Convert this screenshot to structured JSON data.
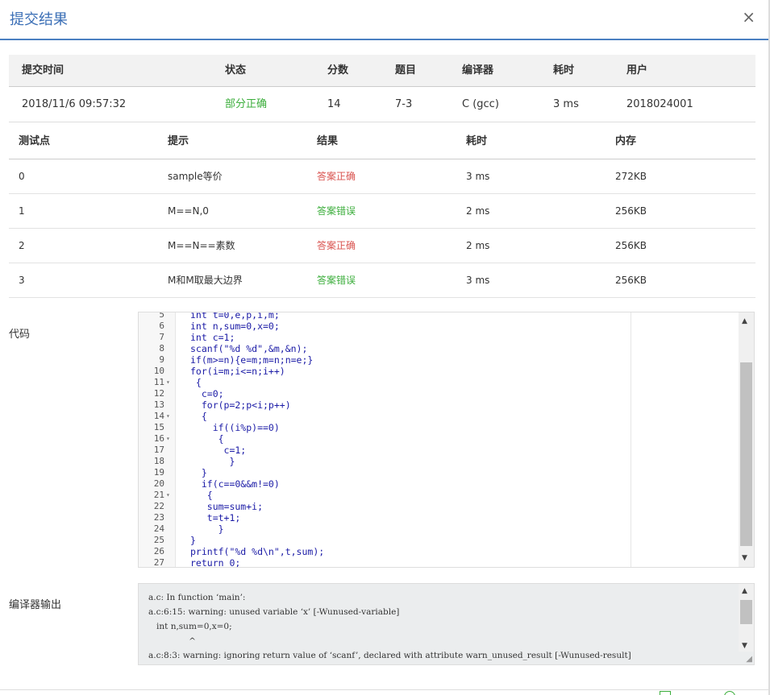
{
  "modal": {
    "title": "提交结果",
    "close": "×"
  },
  "summary": {
    "headers": [
      "提交时间",
      "状态",
      "分数",
      "题目",
      "编译器",
      "耗时",
      "用户"
    ],
    "row": [
      "2018/11/6 09:57:32",
      "部分正确",
      "14",
      "7-3",
      "C (gcc)",
      "3 ms",
      "2018024001"
    ]
  },
  "tests": {
    "headers": [
      "测试点",
      "提示",
      "结果",
      "耗时",
      "内存"
    ],
    "rows": [
      [
        "0",
        "sample等价",
        "答案正确",
        "3 ms",
        "272KB"
      ],
      [
        "1",
        "M==N,0",
        "答案错误",
        "2 ms",
        "256KB"
      ],
      [
        "2",
        "M==N==素数",
        "答案正确",
        "2 ms",
        "256KB"
      ],
      [
        "3",
        "M和M取最大边界",
        "答案错误",
        "3 ms",
        "256KB"
      ]
    ]
  },
  "code_label": "代码",
  "compiler_label": "编译器输出",
  "code": {
    "lines": [
      {
        "n": "5",
        "fold": "",
        "text": "int t=0,e,p,i,m;"
      },
      {
        "n": "6",
        "fold": "",
        "text": "int n,sum=0,x=0;"
      },
      {
        "n": "7",
        "fold": "",
        "text": "int c=1;"
      },
      {
        "n": "8",
        "fold": "",
        "text": "scanf(\"%d %d\",&m,&n);"
      },
      {
        "n": "9",
        "fold": "",
        "text": "if(m>=n){e=m;m=n;n=e;}"
      },
      {
        "n": "10",
        "fold": "",
        "text": "for(i=m;i<=n;i++)"
      },
      {
        "n": "11",
        "fold": "▾",
        "text": " {"
      },
      {
        "n": "12",
        "fold": "",
        "text": "  c=0;"
      },
      {
        "n": "13",
        "fold": "",
        "text": "  for(p=2;p<i;p++)"
      },
      {
        "n": "14",
        "fold": "▾",
        "text": "  {"
      },
      {
        "n": "15",
        "fold": "",
        "text": "    if((i%p)==0)"
      },
      {
        "n": "16",
        "fold": "▾",
        "text": "     {"
      },
      {
        "n": "17",
        "fold": "",
        "text": "      c=1;"
      },
      {
        "n": "18",
        "fold": "",
        "text": "       }"
      },
      {
        "n": "19",
        "fold": "",
        "text": "  }"
      },
      {
        "n": "20",
        "fold": "",
        "text": "  if(c==0&&m!=0)"
      },
      {
        "n": "21",
        "fold": "▾",
        "text": "   {"
      },
      {
        "n": "22",
        "fold": "",
        "text": "   sum=sum+i;"
      },
      {
        "n": "23",
        "fold": "",
        "text": "   t=t+1;"
      },
      {
        "n": "24",
        "fold": "",
        "text": "     }"
      },
      {
        "n": "25",
        "fold": "",
        "text": "}"
      },
      {
        "n": "26",
        "fold": "",
        "text": "printf(\"%d %d\\n\",t,sum);"
      },
      {
        "n": "27",
        "fold": "",
        "text": "return 0;"
      }
    ]
  },
  "compiler_output": [
    "a.c: In function ‘main’:",
    "a.c:6:15: warning: unused variable ‘x’ [-Wunused-variable]",
    "   int n,sum=0,x=0;",
    "               ^",
    "a.c:8:3: warning: ignoring return value of ‘scanf’, declared with attribute warn_unused_result [-Wunused-result]"
  ],
  "colors": {
    "accent": "#3b6fb6",
    "success": "#3cae3c",
    "error": "#d9534f"
  }
}
